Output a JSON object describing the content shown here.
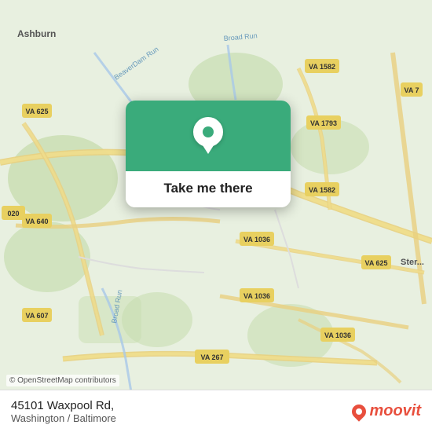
{
  "map": {
    "copyright": "© OpenStreetMap contributors",
    "background_color": "#e8f0e0"
  },
  "card": {
    "button_label": "Take me there"
  },
  "info_bar": {
    "address": "45101 Waxpool Rd,",
    "city": "Washington / Baltimore"
  },
  "moovit": {
    "logo_text": "moovit"
  },
  "road_labels": [
    {
      "id": "va625_nw",
      "text": "VA 625"
    },
    {
      "id": "va1582_ne",
      "text": "VA 1582"
    },
    {
      "id": "va7",
      "text": "VA 7"
    },
    {
      "id": "va1793",
      "text": "VA 1793"
    },
    {
      "id": "va640",
      "text": "VA 640"
    },
    {
      "id": "va1582_e",
      "text": "VA 1582"
    },
    {
      "id": "va625_se",
      "text": "VA 625"
    },
    {
      "id": "va1036_c",
      "text": "VA 1036"
    },
    {
      "id": "va1036_s",
      "text": "VA 1036"
    },
    {
      "id": "va1036_se",
      "text": "VA 1036"
    },
    {
      "id": "va267",
      "text": "VA 267"
    },
    {
      "id": "va607",
      "text": "VA 607"
    },
    {
      "id": "broad_run_s",
      "text": "Broad Run"
    },
    {
      "id": "broad_run_n",
      "text": "Broad Run"
    },
    {
      "id": "beaver_dam",
      "text": "BeaverDam Run"
    },
    {
      "id": "i020",
      "text": "020"
    },
    {
      "id": "ashburn",
      "text": "Ashburn"
    },
    {
      "id": "sterling",
      "text": "Ster..."
    }
  ]
}
